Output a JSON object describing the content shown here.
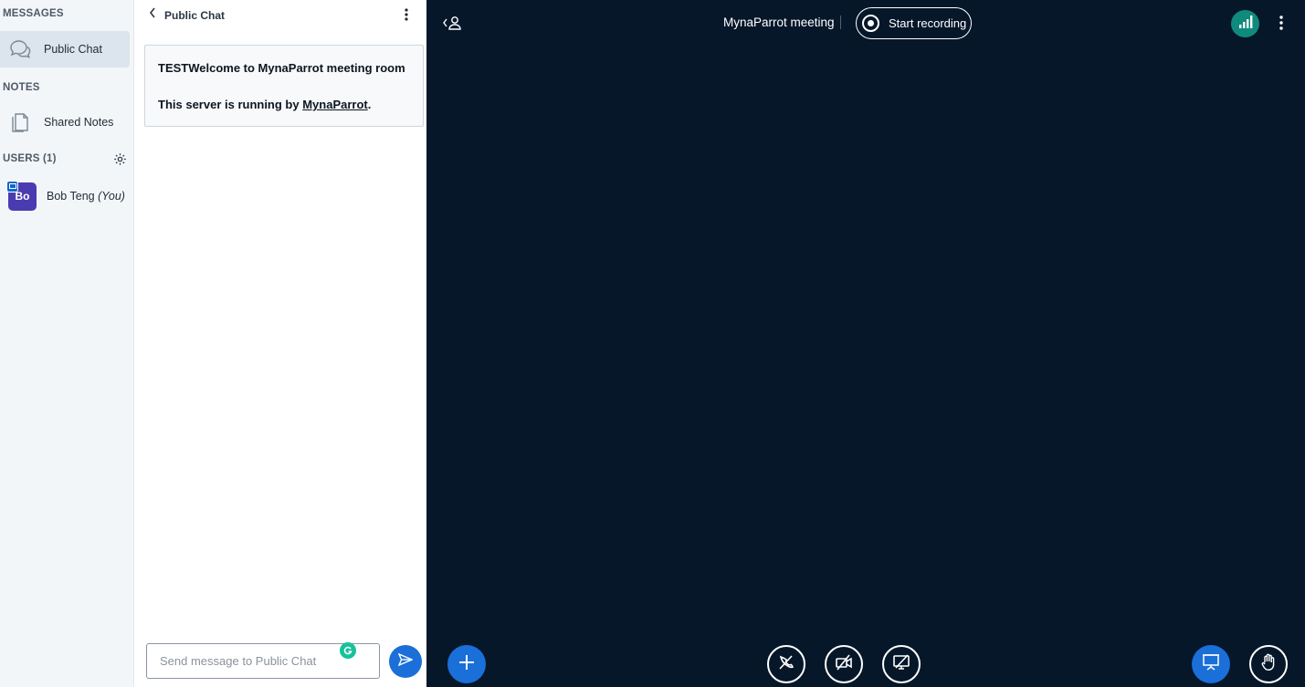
{
  "sidebar": {
    "messages_title": "MESSAGES",
    "public_chat_label": "Public Chat",
    "notes_title": "NOTES",
    "shared_notes_label": "Shared Notes",
    "users_title": "USERS (1)",
    "users": [
      {
        "initials": "Bo",
        "name": "Bob Teng",
        "you_label": "(You)"
      }
    ]
  },
  "chat": {
    "header_title": "Public Chat",
    "welcome_line1": "TESTWelcome to MynaParrot meeting room",
    "welcome_line2_prefix": "This server is running by ",
    "welcome_link": "MynaParrot",
    "welcome_line2_suffix": ".",
    "input_placeholder": "Send message to Public Chat"
  },
  "stage": {
    "meeting_title": "MynaParrot meeting",
    "record_label": "Start recording"
  },
  "colors": {
    "stage_bg": "#06172a",
    "accent_blue": "#1a6fd9",
    "connection_green": "#0f8a7c",
    "avatar_purple": "#4b3bb0"
  },
  "icons": {
    "public_chat": "chat-bubbles-icon",
    "shared_notes": "notes-icon",
    "settings": "gear-icon",
    "actions": "plus-icon",
    "audio": "mic-muted-icon",
    "video": "video-off-icon",
    "screenshare": "screenshare-off-icon",
    "presentation": "presentation-icon",
    "raise_hand": "hand-icon"
  }
}
